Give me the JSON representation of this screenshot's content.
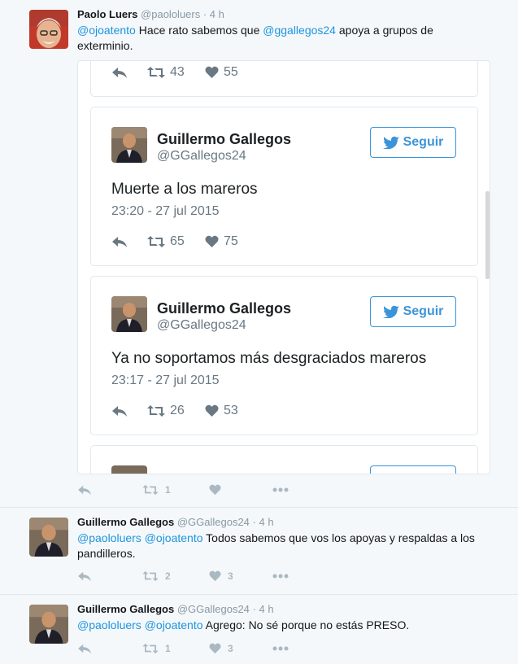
{
  "tweets": [
    {
      "name": "Paolo Luers",
      "handle": "@paololuers",
      "time": "· 4 h",
      "mentions": [
        "@ojoatento"
      ],
      "text_after_mentions": " Hace rato sabemos que ",
      "mention2": "@ggallegos24",
      "text_end": " apoya a grupos de exterminio.",
      "retweets": "1",
      "likes": ""
    },
    {
      "name": "Guillermo Gallegos",
      "handle": "@GGallegos24",
      "time": "· 4 h",
      "mention_a": "@paololuers",
      "mention_b": "@ojoatento",
      "text": " Todos sabemos que vos los apoyas y respaldas a los pandilleros.",
      "retweets": "2",
      "likes": "3"
    },
    {
      "name": "Guillermo Gallegos",
      "handle": "@GGallegos24",
      "time": "· 4 h",
      "mention_a": "@paololuers",
      "mention_b": "@ojoatento",
      "text": " Agrego: No sé porque no estás PRESO.",
      "retweets": "1",
      "likes": "3"
    }
  ],
  "embed": {
    "top_partial": {
      "retweets": "43",
      "likes": "55"
    },
    "cards": [
      {
        "name": "Guillermo Gallegos",
        "handle": "@GGallegos24",
        "follow_label": "Seguir",
        "text": "Muerte a los mareros",
        "date": "23:20 - 27 jul 2015",
        "retweets": "65",
        "likes": "75"
      },
      {
        "name": "Guillermo Gallegos",
        "handle": "@GGallegos24",
        "follow_label": "Seguir",
        "text": "Ya no soportamos más desgraciados mareros",
        "date": "23:17 - 27 jul 2015",
        "retweets": "26",
        "likes": "53"
      }
    ]
  },
  "colors": {
    "mention": "#1b95e0",
    "follow": "#3b94d9",
    "background": "#f5f8fa"
  }
}
